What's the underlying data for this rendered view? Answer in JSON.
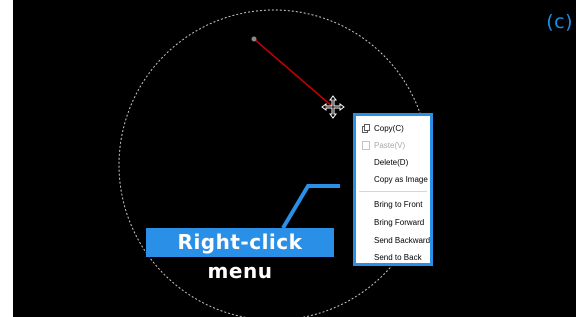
{
  "figure_label": "(c)",
  "context_menu": {
    "items": [
      {
        "label": "Copy(C)",
        "enabled": true,
        "icon": "copy-icon"
      },
      {
        "label": "Paste(V)",
        "enabled": false,
        "icon": "paste-icon"
      },
      {
        "label": "Delete(D)",
        "enabled": true,
        "icon": ""
      },
      {
        "label": "Copy as Image",
        "enabled": true,
        "icon": ""
      },
      {
        "label": "Bring to Front",
        "enabled": true,
        "icon": ""
      },
      {
        "label": "Bring Forward",
        "enabled": true,
        "icon": ""
      },
      {
        "label": "Send Backward",
        "enabled": true,
        "icon": ""
      },
      {
        "label": "Send to Back",
        "enabled": true,
        "icon": ""
      }
    ]
  },
  "callout_label": "Right-click menu",
  "colors": {
    "canvas_background": "#000000",
    "selected_line": "#c40000",
    "circle_outline": "#c8c8c8",
    "accent": "#2a8fe6",
    "disabled_text": "#a9a9a9"
  },
  "icons": [
    "move-cursor-icon",
    "copy-icon",
    "paste-icon"
  ]
}
